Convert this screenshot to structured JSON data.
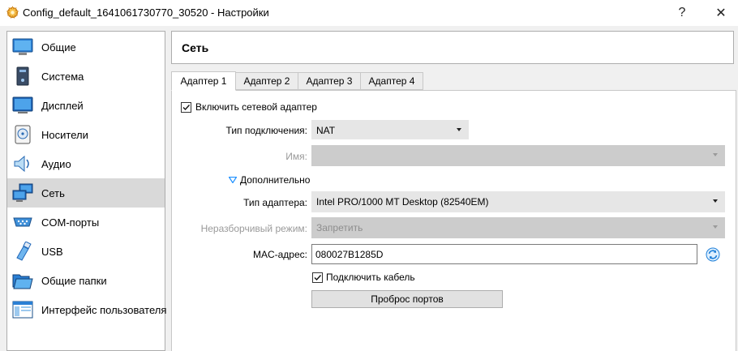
{
  "window": {
    "title": "Config_default_1641061730770_30520 - Настройки",
    "help_glyph": "?",
    "close_glyph": "✕"
  },
  "sidebar": {
    "items": [
      {
        "label": "Общие",
        "icon": "general-icon",
        "selected": false
      },
      {
        "label": "Система",
        "icon": "system-icon",
        "selected": false
      },
      {
        "label": "Дисплей",
        "icon": "display-icon",
        "selected": false
      },
      {
        "label": "Носители",
        "icon": "storage-icon",
        "selected": false
      },
      {
        "label": "Аудио",
        "icon": "audio-icon",
        "selected": false
      },
      {
        "label": "Сеть",
        "icon": "network-icon",
        "selected": true
      },
      {
        "label": "COM-порты",
        "icon": "serial-ports-icon",
        "selected": false
      },
      {
        "label": "USB",
        "icon": "usb-icon",
        "selected": false
      },
      {
        "label": "Общие папки",
        "icon": "shared-folders-icon",
        "selected": false
      },
      {
        "label": "Интерфейс пользователя",
        "icon": "user-interface-icon",
        "selected": false
      }
    ]
  },
  "header": {
    "title": "Сеть"
  },
  "tabs": [
    {
      "label": "Адаптер 1",
      "active": true
    },
    {
      "label": "Адаптер 2",
      "active": false
    },
    {
      "label": "Адаптер 3",
      "active": false
    },
    {
      "label": "Адаптер 4",
      "active": false
    }
  ],
  "adapter": {
    "enable_label": "Включить сетевой адаптер",
    "enable_checked": true,
    "attached_to_label": "Тип подключения:",
    "attached_to_value": "NAT",
    "name_label": "Имя:",
    "name_value": "",
    "advanced_label": "Дополнительно",
    "adapter_type_label": "Тип адаптера:",
    "adapter_type_value": "Intel PRO/1000 MT Desktop (82540EM)",
    "promiscuous_label": "Неразборчивый режим:",
    "promiscuous_value": "Запретить",
    "mac_label": "MAC-адрес:",
    "mac_value": "080027B1285D",
    "cable_label": "Подключить кабель",
    "cable_checked": true,
    "port_forwarding_label": "Проброс портов"
  },
  "colors": {
    "selection": "#d9d9d9",
    "accent_blue": "#1e90ff",
    "disabled_text": "#9a9a9a"
  }
}
